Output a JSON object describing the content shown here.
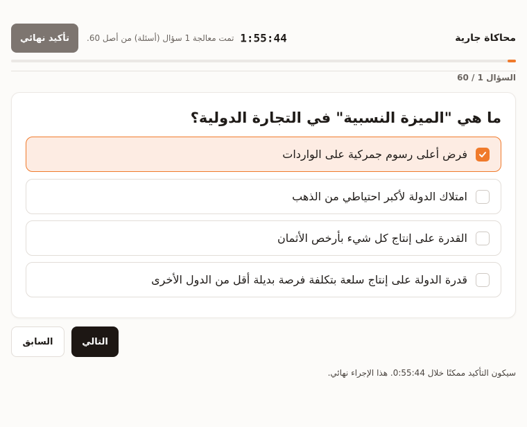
{
  "header": {
    "title": "محاكاة جارية",
    "timer": "1:55:44",
    "processed_text": "تمت معالجة 1 سؤال (أسئلة) من أصل 60.",
    "final_confirm_label": "تأكيد نهائي"
  },
  "progress": {
    "fraction": 0.0167,
    "counter_text": "السؤال 1 / 60",
    "accent_color": "#f07a2b"
  },
  "question": {
    "text": "ما هي \"الميزة النسبية\" في التجارة الدولية؟",
    "options": [
      {
        "label": "فرض أعلى رسوم جمركية على الواردات",
        "selected": true
      },
      {
        "label": "امتلاك الدولة لأكبر احتياطي من الذهب",
        "selected": false
      },
      {
        "label": "القدرة على إنتاج كل شيء بأرخص الأثمان",
        "selected": false
      },
      {
        "label": "قدرة الدولة على إنتاج سلعة بتكلفة فرصة بديلة أقل من الدول الأخرى",
        "selected": false
      }
    ]
  },
  "nav": {
    "next_label": "التالي",
    "prev_label": "السابق"
  },
  "footer": {
    "note": "سيكون التأكيد ممكنًا خلال 0:55:44. هذا الإجراء نهائي."
  },
  "icons": {
    "checkbox_checked": "check-icon"
  }
}
